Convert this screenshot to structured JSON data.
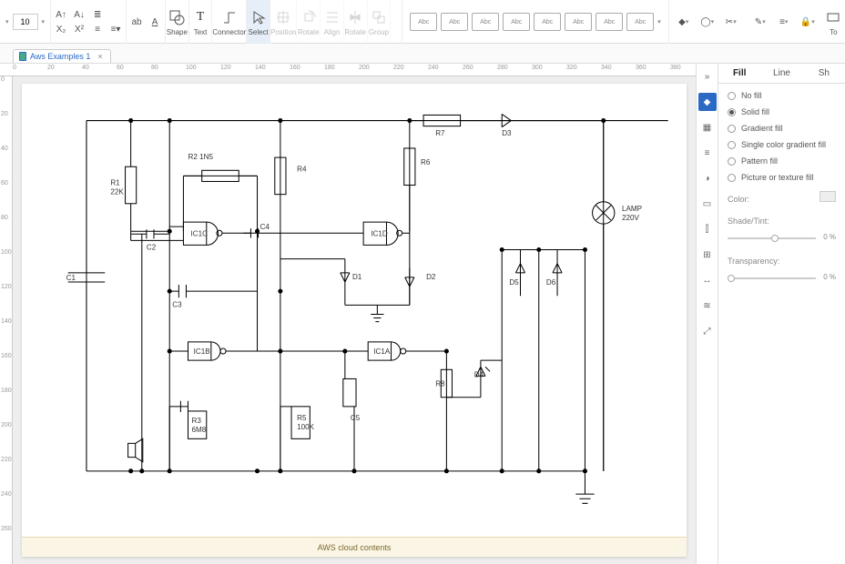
{
  "ribbon": {
    "fontsize": "10",
    "shape": "Shape",
    "text": "Text",
    "connector": "Connector",
    "select": "Select",
    "position": "Position",
    "rotate": "Rotate",
    "align": "Align",
    "rotate2": "Rotate",
    "group": "Group",
    "to": "To",
    "style_label": "Abc"
  },
  "tab": {
    "name": "Aws Examples 1",
    "close": "×"
  },
  "ruler_h": [
    "0",
    "20",
    "40",
    "60",
    "80",
    "100",
    "120",
    "140",
    "160",
    "180",
    "200",
    "220",
    "240",
    "260",
    "280",
    "300",
    "320",
    "340",
    "360",
    "380"
  ],
  "ruler_v": [
    "0",
    "20",
    "40",
    "60",
    "80",
    "100",
    "120",
    "140",
    "160",
    "180",
    "200",
    "220",
    "240",
    "260"
  ],
  "doc_caption": "AWS cloud contents",
  "side_collapse": "»",
  "props": {
    "tab_fill": "Fill",
    "tab_line": "Line",
    "tab_sh": "Sh",
    "no_fill": "No fill",
    "solid_fill": "Solid fill",
    "gradient_fill": "Gradient fill",
    "single_grad": "Single color gradient fill",
    "pattern_fill": "Pattern fill",
    "picture_fill": "Picture or texture fill",
    "color": "Color:",
    "shade": "Shade/Tint:",
    "shade_val": "0 %",
    "transparency": "Transparency:",
    "transparency_val": "0 %"
  },
  "schematic": {
    "C1": "C1",
    "R1": "R1",
    "R1v": "22K",
    "R2": "R2  1N5",
    "C2": "C2",
    "C3": "C3",
    "C4": "C4",
    "IC1C": "IC1C",
    "R4": "R4",
    "R6": "R6",
    "R7": "R7",
    "D3": "D3",
    "IC1D": "IC1D",
    "D1": "D1",
    "D2": "D2",
    "D5": "D5",
    "D6": "D6",
    "LAMP": "LAMP",
    "LAMPV": "220V",
    "IC1B": "IC1B",
    "IC1A": "IC1A",
    "R8": "R8",
    "D4": "D4",
    "R3": "R3",
    "R3v": "6M8",
    "R5": "R5",
    "R5v": "100K",
    "C5": "C5"
  }
}
